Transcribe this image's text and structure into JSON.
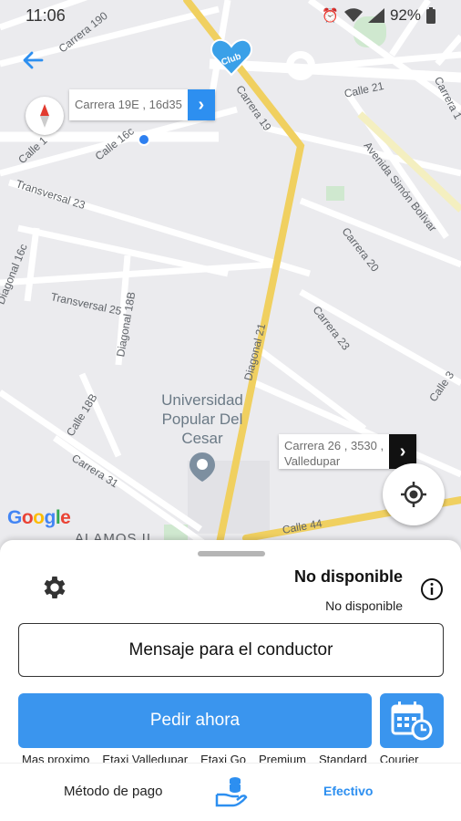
{
  "status_bar": {
    "time": "11:06",
    "battery": "92%"
  },
  "map": {
    "street_labels": [
      "Carrera 190",
      "Calle 1",
      "Calle 16c",
      "Carrera 19",
      "Calle 21",
      "Carrera 1",
      "Avenida Simón Bolívar",
      "Transversal 23",
      "Diagonal 16c",
      "Carrera 20",
      "Transversal 25",
      "Diagonal 18B",
      "Carrera 23",
      "Diagonal 21",
      "Calle 18B",
      "Carrera 31",
      "Calle 44",
      "Calle 3",
      "ALAMOS II"
    ],
    "poi": "Universidad Popular Del Cesar",
    "google": "Google",
    "origin_address": "Carrera 19E , 16d35",
    "destination_address_line1": "Carrera 26 , 3530 ,",
    "destination_address_line2": "Valledupar"
  },
  "sheet": {
    "availability_title": "No disponible",
    "availability_sub": "No disponible",
    "message_button": "Mensaje para el conductor",
    "order_button": "Pedir ahora",
    "services": [
      "Mas proximo",
      "Etaxi Valledupar",
      "Etaxi Go",
      "Premium",
      "Standard",
      "Courier"
    ]
  },
  "bottom_bar": {
    "payment_label": "Método de pago",
    "payment_value": "Efectivo"
  },
  "colors": {
    "accent": "#3a95ee",
    "road_major": "#f6d96b",
    "map_bg": "#ebebee"
  },
  "icons": [
    "back-arrow-icon",
    "compass-icon",
    "club-logo",
    "gear-icon",
    "info-icon",
    "locate-icon",
    "calendar-clock-icon",
    "cash-hand-icon"
  ]
}
